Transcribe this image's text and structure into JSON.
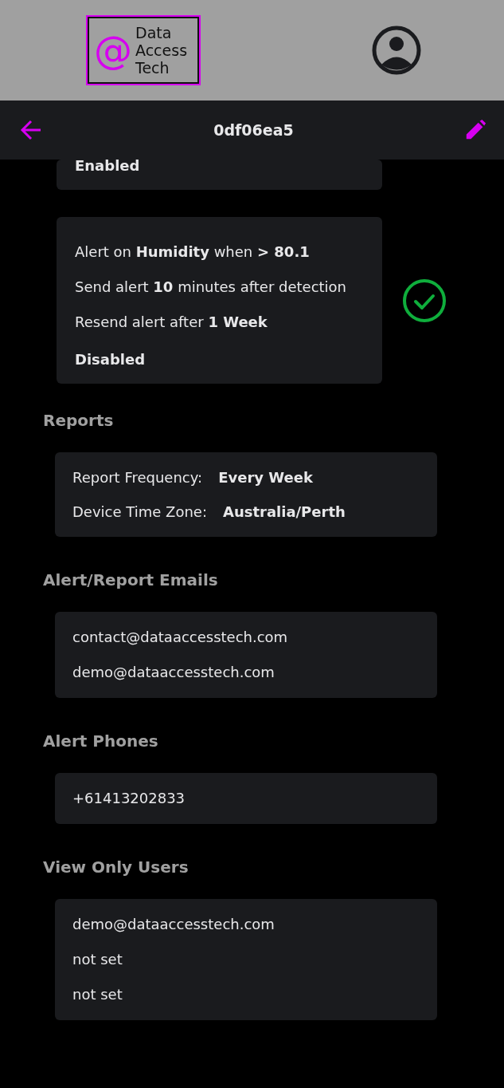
{
  "header": {
    "logo": {
      "symbol": "@",
      "lines": [
        "Data",
        "Access",
        "Tech"
      ]
    }
  },
  "toolbar": {
    "title": "0df06ea5"
  },
  "alerts": [
    {
      "status": "Enabled"
    },
    {
      "lines": [
        "Alert on **Humidity** when **> 80.1**",
        "Send alert **10** minutes after detection",
        "Resend alert after **1 Week**"
      ],
      "status": "Disabled",
      "checked": true
    }
  ],
  "sections": [
    {
      "title": "Reports",
      "kind": "settings",
      "rows": [
        {
          "label": "Report Frequency:",
          "value": "Every Week"
        },
        {
          "label": "Device Time Zone:",
          "value": "Australia/Perth"
        }
      ]
    },
    {
      "title": "Alert/Report Emails",
      "kind": "list",
      "items": [
        "contact@dataaccesstech.com",
        "demo@dataaccesstech.com"
      ]
    },
    {
      "title": "Alert Phones",
      "kind": "list",
      "items": [
        "+61413202833"
      ]
    },
    {
      "title": "View Only Users",
      "kind": "list",
      "items": [
        "demo@dataaccesstech.com",
        "not set",
        "not set"
      ]
    }
  ]
}
